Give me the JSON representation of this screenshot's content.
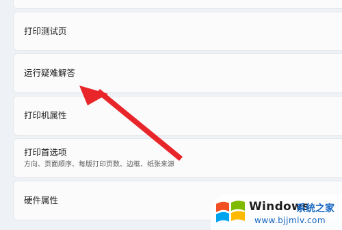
{
  "settings": {
    "items": [
      {
        "title": ""
      },
      {
        "title": "打印测试页"
      },
      {
        "title": "运行疑难解答"
      },
      {
        "title": "打印机属性"
      },
      {
        "title": "打印首选项",
        "description": "方向、页面顺序、每版打印页数、边框、纸张来源"
      },
      {
        "title": "硬件属性"
      }
    ]
  },
  "annotation": {
    "arrow_color": "#e8262a",
    "arrow_icon": "red-arrow"
  },
  "watermark": {
    "brand": "Windows",
    "site_name": "系统之家",
    "url": "www.bjjmlv.com",
    "logo_icon": "windows-flag-icon",
    "colors": {
      "red": "#f25022",
      "green": "#7fba00",
      "blue": "#00a4ef",
      "yellow": "#ffb900",
      "text_blue": "#1565c0"
    }
  }
}
